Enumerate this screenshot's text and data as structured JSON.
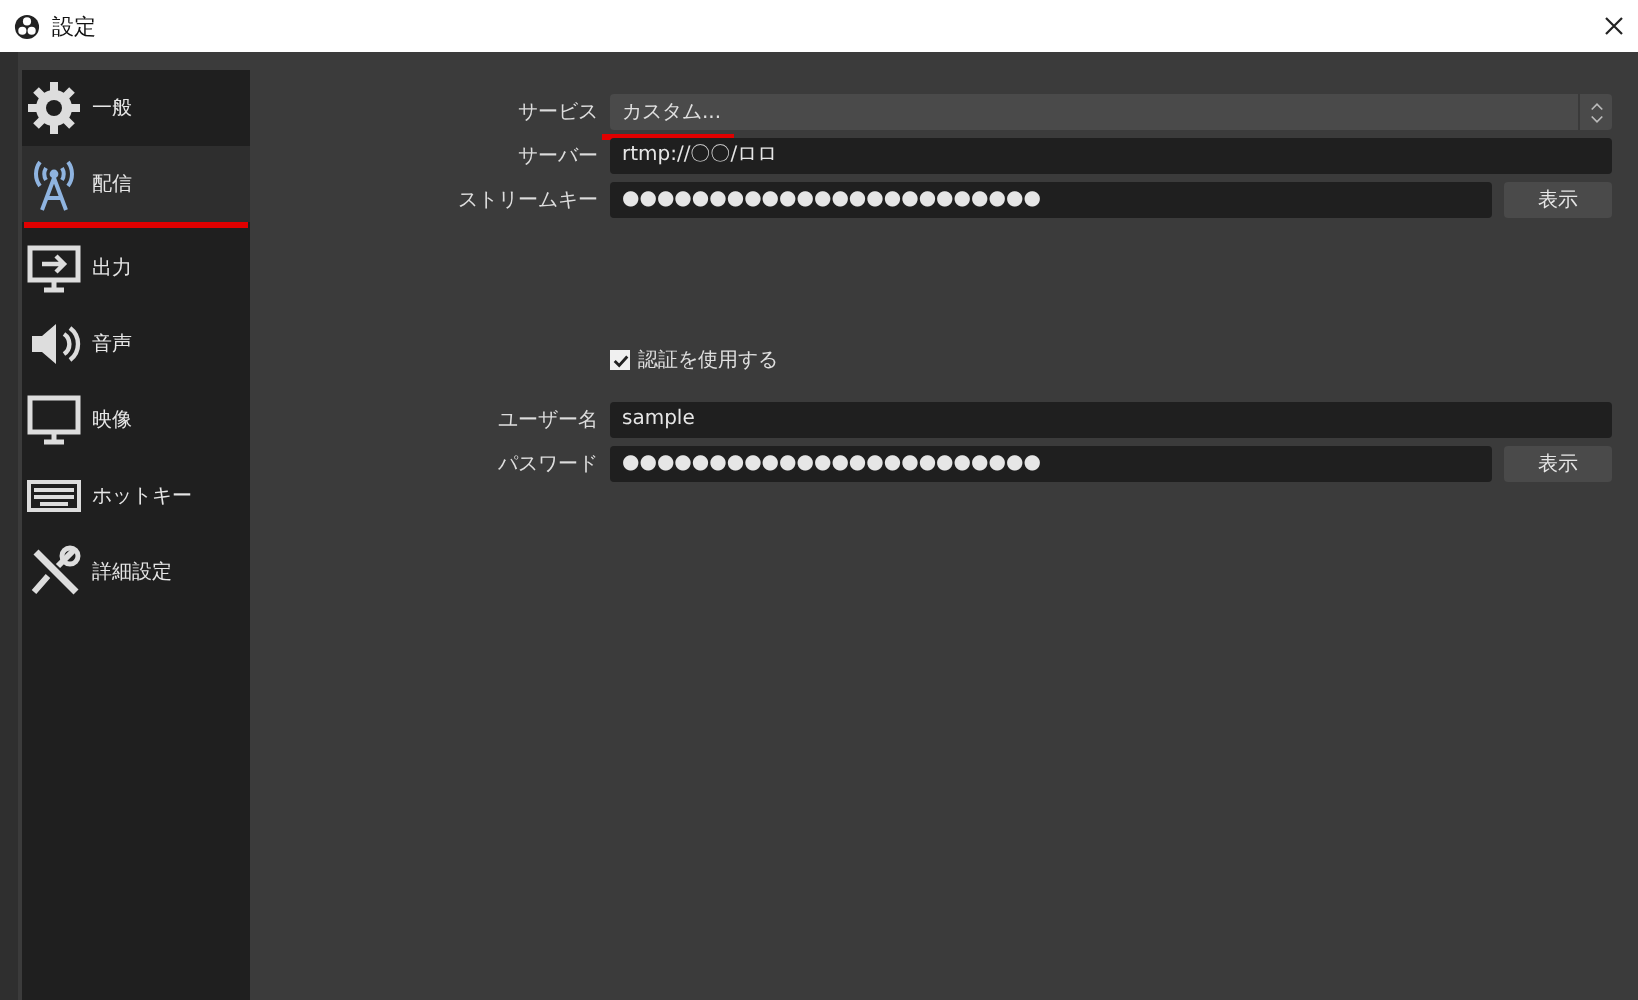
{
  "window": {
    "title": "設定"
  },
  "sidebar": {
    "items": [
      {
        "label": "一般",
        "kind": "gear",
        "selected": false,
        "annotated": false
      },
      {
        "label": "配信",
        "kind": "antenna",
        "selected": true,
        "annotated": true
      },
      {
        "label": "出力",
        "kind": "output",
        "selected": false,
        "annotated": false
      },
      {
        "label": "音声",
        "kind": "speaker",
        "selected": false,
        "annotated": false
      },
      {
        "label": "映像",
        "kind": "monitor",
        "selected": false,
        "annotated": false
      },
      {
        "label": "ホットキー",
        "kind": "keyboard",
        "selected": false,
        "annotated": false
      },
      {
        "label": "詳細設定",
        "kind": "tools",
        "selected": false,
        "annotated": false
      }
    ]
  },
  "form": {
    "rows": [
      {
        "kind": "select",
        "label": "サービス",
        "value": "カスタム...",
        "annotated": true
      },
      {
        "kind": "text",
        "label": "サーバー",
        "value": "rtmp://〇〇/ロロ"
      },
      {
        "kind": "secret",
        "label": "ストリームキー",
        "value": "●●●●●●●●●●●●●●●●●●●●●●●●",
        "button": "表示"
      },
      {
        "kind": "gap"
      },
      {
        "kind": "checkbox",
        "label": "認証を使用する",
        "checked": true
      },
      {
        "kind": "text",
        "label": "ユーザー名",
        "value": "sample"
      },
      {
        "kind": "secret",
        "label": "パスワード",
        "value": "●●●●●●●●●●●●●●●●●●●●●●●●",
        "button": "表示"
      }
    ]
  }
}
